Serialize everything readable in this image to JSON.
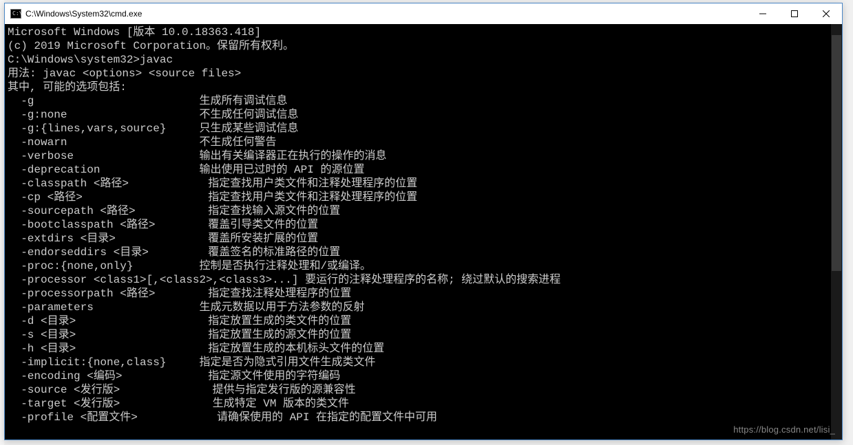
{
  "window": {
    "title": "C:\\Windows\\System32\\cmd.exe"
  },
  "terminal": {
    "lines": [
      "Microsoft Windows [版本 10.0.18363.418]",
      "(c) 2019 Microsoft Corporation。保留所有权利。",
      "",
      "C:\\Windows\\system32>javac",
      "用法: javac <options> <source files>",
      "其中, 可能的选项包括:",
      "  -g                         生成所有调试信息",
      "  -g:none                    不生成任何调试信息",
      "  -g:{lines,vars,source}     只生成某些调试信息",
      "  -nowarn                    不生成任何警告",
      "  -verbose                   输出有关编译器正在执行的操作的消息",
      "  -deprecation               输出使用已过时的 API 的源位置",
      "  -classpath <路径>            指定查找用户类文件和注释处理程序的位置",
      "  -cp <路径>                   指定查找用户类文件和注释处理程序的位置",
      "  -sourcepath <路径>           指定查找输入源文件的位置",
      "  -bootclasspath <路径>        覆盖引导类文件的位置",
      "  -extdirs <目录>              覆盖所安装扩展的位置",
      "  -endorseddirs <目录>         覆盖签名的标准路径的位置",
      "  -proc:{none,only}          控制是否执行注释处理和/或编译。",
      "  -processor <class1>[,<class2>,<class3>...] 要运行的注释处理程序的名称; 绕过默认的搜索进程",
      "  -processorpath <路径>        指定查找注释处理程序的位置",
      "  -parameters                生成元数据以用于方法参数的反射",
      "  -d <目录>                    指定放置生成的类文件的位置",
      "  -s <目录>                    指定放置生成的源文件的位置",
      "  -h <目录>                    指定放置生成的本机标头文件的位置",
      "  -implicit:{none,class}     指定是否为隐式引用文件生成类文件",
      "  -encoding <编码>             指定源文件使用的字符编码",
      "  -source <发行版>              提供与指定发行版的源兼容性",
      "  -target <发行版>              生成特定 VM 版本的类文件",
      "  -profile <配置文件>            请确保使用的 API 在指定的配置文件中可用"
    ]
  },
  "watermark": "https://blog.csdn.net/lisi_"
}
